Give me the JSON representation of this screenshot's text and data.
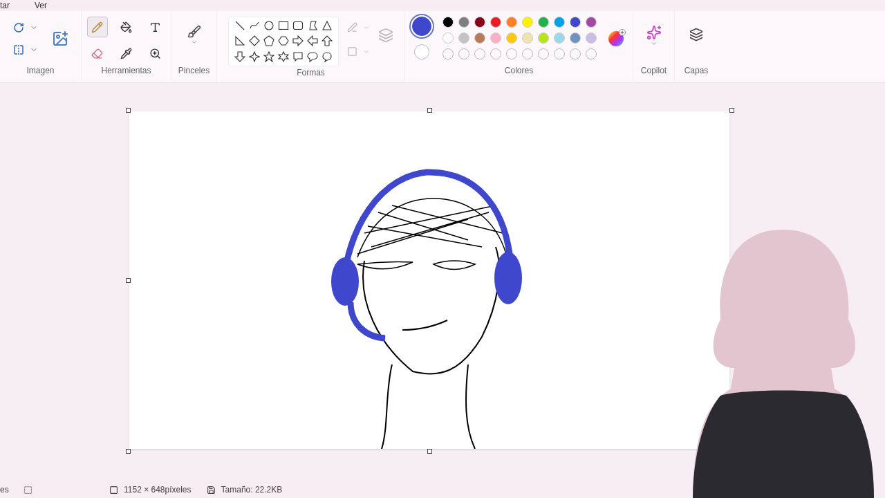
{
  "menu_bar": {
    "items": [
      "tar",
      "Ver"
    ]
  },
  "ribbon": {
    "groups": [
      {
        "label": "Imagen"
      },
      {
        "label": "Herramientas"
      },
      {
        "label": "Pinceles"
      },
      {
        "label": "Formas"
      },
      {
        "label": "Colores"
      },
      {
        "label": "Copilot"
      },
      {
        "label": "Capas"
      }
    ],
    "tools": [
      {
        "kind": "pencil",
        "selected": true
      },
      {
        "kind": "fill",
        "selected": false
      },
      {
        "kind": "text",
        "selected": false
      },
      {
        "kind": "eraser",
        "selected": false
      },
      {
        "kind": "picker",
        "selected": false
      },
      {
        "kind": "zoom",
        "selected": false
      }
    ],
    "current_colors": [
      {
        "color": "#3f48cc",
        "selected": true
      },
      {
        "color": "#ffffff",
        "selected": false
      }
    ],
    "palette": [
      {
        "color": "#000000"
      },
      {
        "color": "#7f7f7f"
      },
      {
        "color": "#880015"
      },
      {
        "color": "#ed1c24"
      },
      {
        "color": "#ff7f27"
      },
      {
        "color": "#fff200"
      },
      {
        "color": "#22b14c"
      },
      {
        "color": "#00a2e8"
      },
      {
        "color": "#3f48cc"
      },
      {
        "color": "#a349a4"
      },
      {
        "color": "#ffffff"
      },
      {
        "color": "#c3c3c3"
      },
      {
        "color": "#b97a57"
      },
      {
        "color": "#ffaec9"
      },
      {
        "color": "#ffc90e"
      },
      {
        "color": "#efe4b0"
      },
      {
        "color": "#b5e61d"
      },
      {
        "color": "#99d9ea"
      },
      {
        "color": "#7092be"
      },
      {
        "color": "#c8bfe7"
      }
    ]
  },
  "status_bar": {
    "left": "es",
    "dimensions": "1152 × 648píxeles",
    "size": "Tamaño: 22.2KB"
  }
}
